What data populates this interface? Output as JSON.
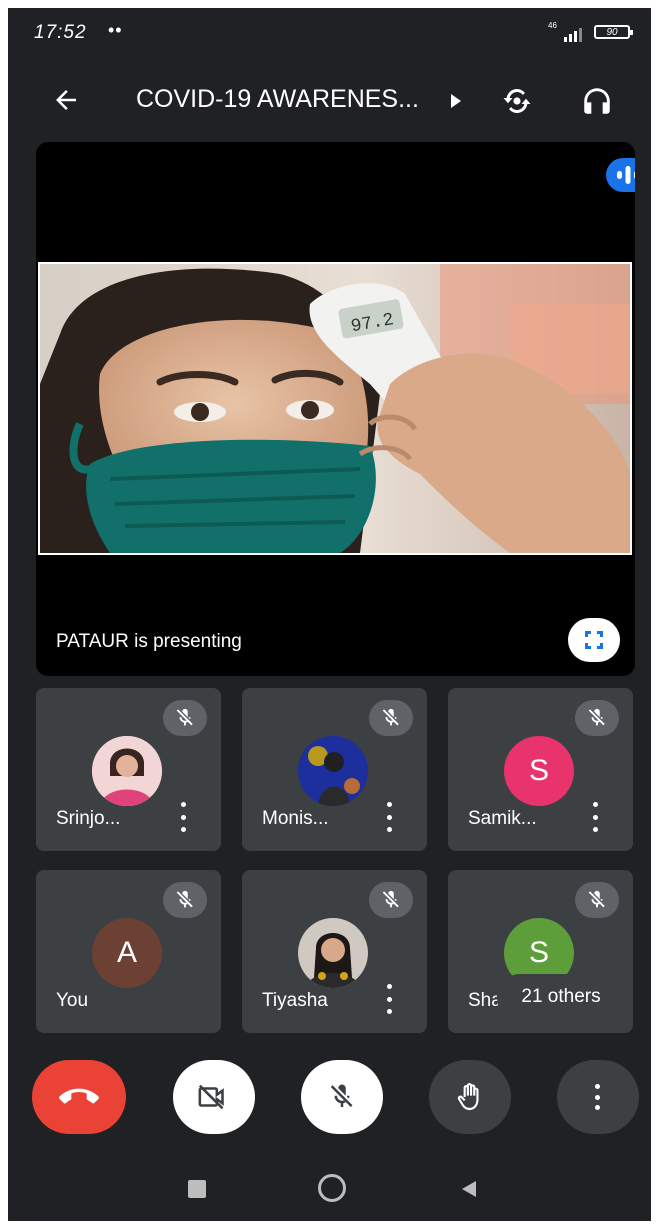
{
  "status_bar": {
    "time": "17:52",
    "dots": "••",
    "network": "46",
    "battery": "90"
  },
  "header": {
    "title": "COVID-19 AWARENES...",
    "back_icon": "arrow-back-icon",
    "expand_icon": "caret-right-icon",
    "switch_camera_icon": "switch-camera-icon",
    "audio_icon": "headphones-icon"
  },
  "presentation": {
    "presenter_text": "PATAUR is presenting",
    "thermometer_reading": "97.2",
    "colors": {
      "accent": "#1a73e8"
    }
  },
  "participants": [
    {
      "name": "Srinjo...",
      "avatar": "photo",
      "muted": true
    },
    {
      "name": "Monis...",
      "avatar": "photo",
      "muted": true
    },
    {
      "name": "Samik...",
      "initial": "S",
      "avatar_color": "#e8336d",
      "muted": true
    },
    {
      "name": "You",
      "initial": "A",
      "avatar_color": "#6d4034",
      "muted": true
    },
    {
      "name": "Tiyasha",
      "avatar": "photo",
      "muted": true
    },
    {
      "name": "Sha",
      "initial": "S",
      "avatar_color": "#5d9e3a",
      "muted": true,
      "overlay": "21 others"
    }
  ],
  "controls": {
    "end_call": "end-call-icon",
    "camera": "camera-off-icon",
    "mic": "mic-off-icon",
    "raise_hand": "raise-hand-icon",
    "more": "more-options-icon",
    "colors": {
      "end_call": "#ea4335"
    }
  },
  "nav_bar": [
    "recents-icon",
    "home-icon",
    "back-triangle-icon"
  ]
}
